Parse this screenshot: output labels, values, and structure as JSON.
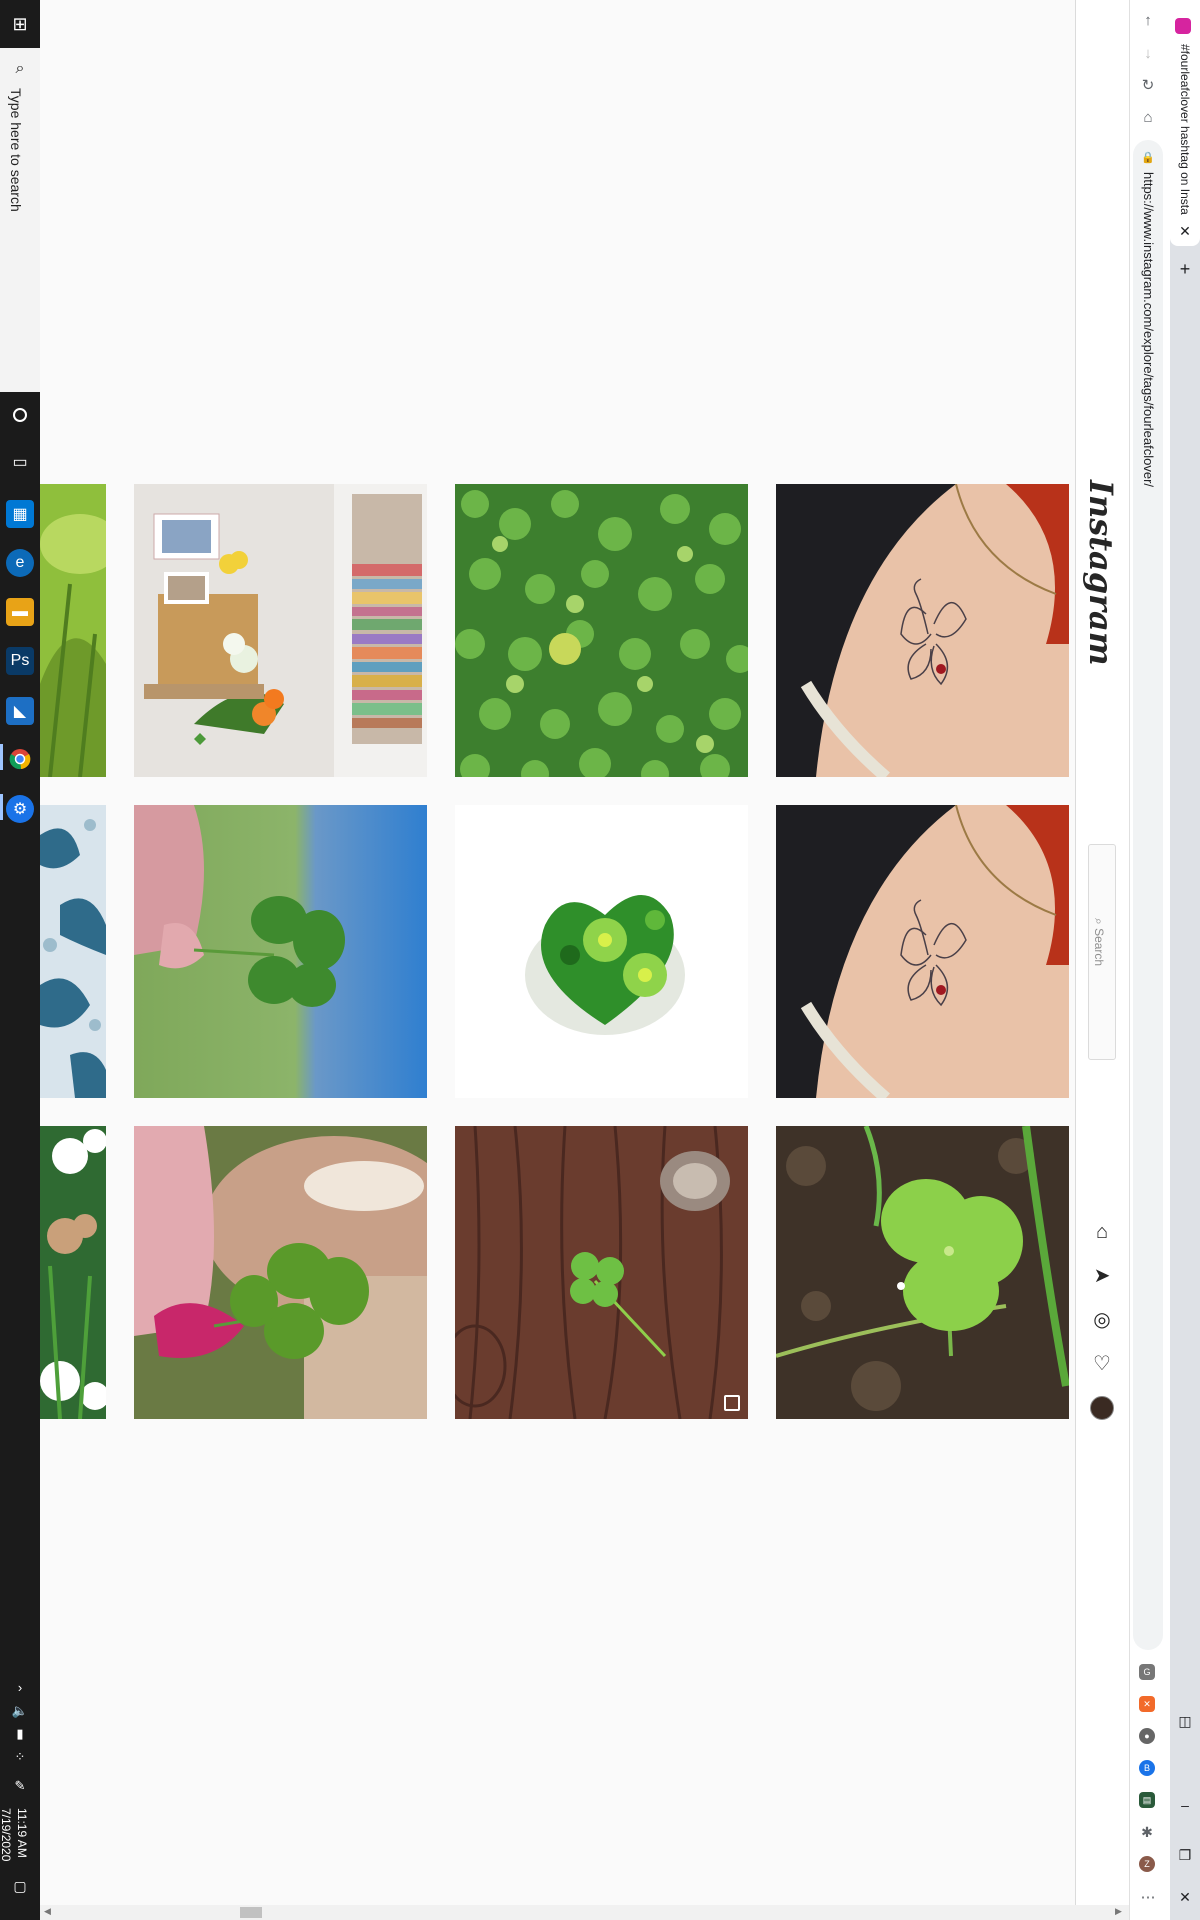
{
  "taskbar": {
    "search_placeholder": "Type here to search",
    "time": "11:19 AM",
    "date": "7/19/2020"
  },
  "browser": {
    "tab_title": "#fourleafclover hashtag on Insta",
    "url": "https://www.instagram.com/explore/tags/fourleafclover/"
  },
  "instagram": {
    "logo": "Instagram",
    "search_placeholder": "Search"
  },
  "grid": {
    "rows": [
      [
        "grass-closeup",
        "bookshelf-flowers",
        "clover-patch",
        "clover-tattoo"
      ],
      [
        "lace-fabric",
        "hand-clover-sky",
        "quilled-clover-heart",
        "clover-tattoo"
      ],
      [
        "white-clover-flowers",
        "hand-clover-horse",
        "clover-on-wood",
        "clover-in-soil"
      ]
    ]
  }
}
